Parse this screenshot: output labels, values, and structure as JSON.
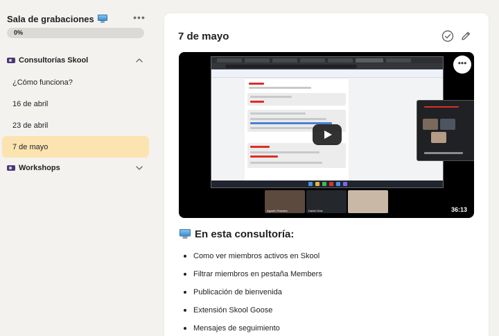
{
  "sidebar": {
    "title": "Sala de grabaciones",
    "title_icon": "desktop-computer-icon",
    "more_label": "•••",
    "progress": {
      "label": "0%",
      "value": 0
    },
    "sections": [
      {
        "label": "Consultorías Skool",
        "icon": "video-camera-icon",
        "expanded": true,
        "lessons": [
          {
            "label": "¿Cómo funciona?",
            "active": false
          },
          {
            "label": "16 de abril",
            "active": false
          },
          {
            "label": "23 de abril",
            "active": false
          },
          {
            "label": "7 de mayo",
            "active": true
          }
        ]
      },
      {
        "label": "Workshops",
        "icon": "video-camera-icon",
        "expanded": false,
        "lessons": []
      }
    ]
  },
  "main": {
    "title": "7 de mayo",
    "video": {
      "duration": "36:13",
      "more_label": "•••",
      "participants": [
        {
          "name": "Agustín Paredes"
        },
        {
          "name": "Daniel Díaz"
        },
        {
          "name": ""
        }
      ]
    },
    "content_heading": "En esta consultoría:",
    "content_icon": "desktop-computer-icon",
    "bullets": [
      "Como ver miembros activos en Skool",
      "Filtrar miembros en pestaña Members",
      "Publicación de bienvenida",
      "Extensión Skool Goose",
      "Mensajes de seguimiento"
    ]
  },
  "colors": {
    "page_bg": "#f4f2ef",
    "active_lesson_bg": "#fce4b1",
    "card_bg": "#ffffff",
    "progress_track": "#dcdad7"
  }
}
